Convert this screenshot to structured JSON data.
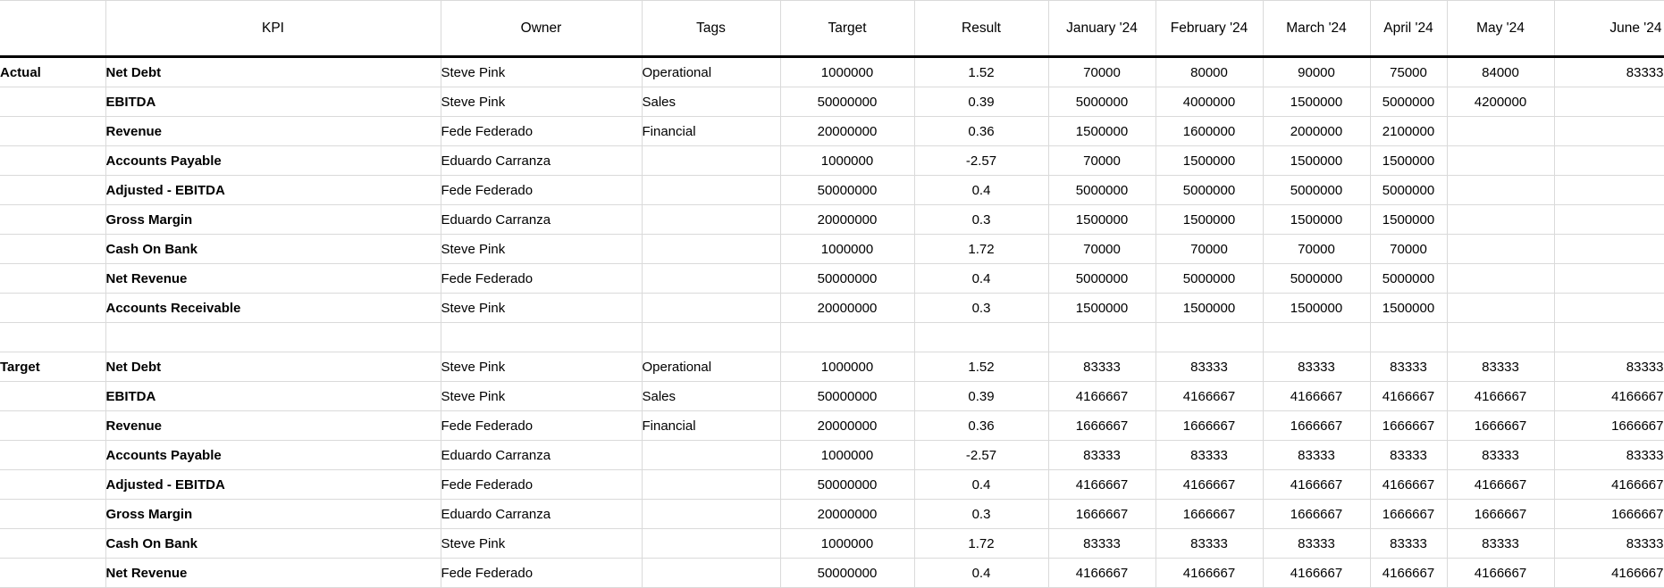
{
  "columns": [
    "",
    "KPI",
    "Owner",
    "Tags",
    "Target",
    "Result",
    "January '24",
    "February '24",
    "March '24",
    "April '24",
    "May '24",
    "June '24"
  ],
  "sections": [
    {
      "label": "Actual",
      "rows": [
        {
          "kpi": "Net Debt",
          "owner": "Steve Pink",
          "tag": "Operational",
          "target": "1000000",
          "result": "1.52",
          "months": [
            "70000",
            "80000",
            "90000",
            "75000",
            "84000",
            "83333"
          ]
        },
        {
          "kpi": "EBITDA",
          "owner": "Steve Pink",
          "tag": "Sales",
          "target": "50000000",
          "result": "0.39",
          "months": [
            "5000000",
            "4000000",
            "1500000",
            "5000000",
            "4200000",
            ""
          ]
        },
        {
          "kpi": "Revenue",
          "owner": "Fede Federado",
          "tag": "Financial",
          "target": "20000000",
          "result": "0.36",
          "months": [
            "1500000",
            "1600000",
            "2000000",
            "2100000",
            "",
            ""
          ]
        },
        {
          "kpi": "Accounts Payable",
          "owner": "Eduardo Carranza",
          "tag": "",
          "target": "1000000",
          "result": "-2.57",
          "months": [
            "70000",
            "1500000",
            "1500000",
            "1500000",
            "",
            ""
          ]
        },
        {
          "kpi": "Adjusted - EBITDA",
          "owner": "Fede Federado",
          "tag": "",
          "target": "50000000",
          "result": "0.4",
          "months": [
            "5000000",
            "5000000",
            "5000000",
            "5000000",
            "",
            ""
          ]
        },
        {
          "kpi": "Gross Margin",
          "owner": "Eduardo Carranza",
          "tag": "",
          "target": "20000000",
          "result": "0.3",
          "months": [
            "1500000",
            "1500000",
            "1500000",
            "1500000",
            "",
            ""
          ]
        },
        {
          "kpi": "Cash On Bank",
          "owner": "Steve Pink",
          "tag": "",
          "target": "1000000",
          "result": "1.72",
          "months": [
            "70000",
            "70000",
            "70000",
            "70000",
            "",
            ""
          ]
        },
        {
          "kpi": "Net Revenue",
          "owner": "Fede Federado",
          "tag": "",
          "target": "50000000",
          "result": "0.4",
          "months": [
            "5000000",
            "5000000",
            "5000000",
            "5000000",
            "",
            ""
          ]
        },
        {
          "kpi": "Accounts Receivable",
          "owner": "Steve Pink",
          "tag": "",
          "target": "20000000",
          "result": "0.3",
          "months": [
            "1500000",
            "1500000",
            "1500000",
            "1500000",
            "",
            ""
          ]
        }
      ]
    },
    {
      "label": "Target",
      "rows": [
        {
          "kpi": "Net Debt",
          "owner": "Steve Pink",
          "tag": "Operational",
          "target": "1000000",
          "result": "1.52",
          "months": [
            "83333",
            "83333",
            "83333",
            "83333",
            "83333",
            "83333"
          ]
        },
        {
          "kpi": "EBITDA",
          "owner": "Steve Pink",
          "tag": "Sales",
          "target": "50000000",
          "result": "0.39",
          "months": [
            "4166667",
            "4166667",
            "4166667",
            "4166667",
            "4166667",
            "4166667"
          ]
        },
        {
          "kpi": "Revenue",
          "owner": "Fede Federado",
          "tag": "Financial",
          "target": "20000000",
          "result": "0.36",
          "months": [
            "1666667",
            "1666667",
            "1666667",
            "1666667",
            "1666667",
            "1666667"
          ]
        },
        {
          "kpi": "Accounts Payable",
          "owner": "Eduardo Carranza",
          "tag": "",
          "target": "1000000",
          "result": "-2.57",
          "months": [
            "83333",
            "83333",
            "83333",
            "83333",
            "83333",
            "83333"
          ]
        },
        {
          "kpi": "Adjusted - EBITDA",
          "owner": "Fede Federado",
          "tag": "",
          "target": "50000000",
          "result": "0.4",
          "months": [
            "4166667",
            "4166667",
            "4166667",
            "4166667",
            "4166667",
            "4166667"
          ]
        },
        {
          "kpi": "Gross Margin",
          "owner": "Eduardo Carranza",
          "tag": "",
          "target": "20000000",
          "result": "0.3",
          "months": [
            "1666667",
            "1666667",
            "1666667",
            "1666667",
            "1666667",
            "1666667"
          ]
        },
        {
          "kpi": "Cash On Bank",
          "owner": "Steve Pink",
          "tag": "",
          "target": "1000000",
          "result": "1.72",
          "months": [
            "83333",
            "83333",
            "83333",
            "83333",
            "83333",
            "83333"
          ]
        },
        {
          "kpi": "Net Revenue",
          "owner": "Fede Federado",
          "tag": "",
          "target": "50000000",
          "result": "0.4",
          "months": [
            "4166667",
            "4166667",
            "4166667",
            "4166667",
            "4166667",
            "4166667"
          ]
        }
      ]
    }
  ]
}
